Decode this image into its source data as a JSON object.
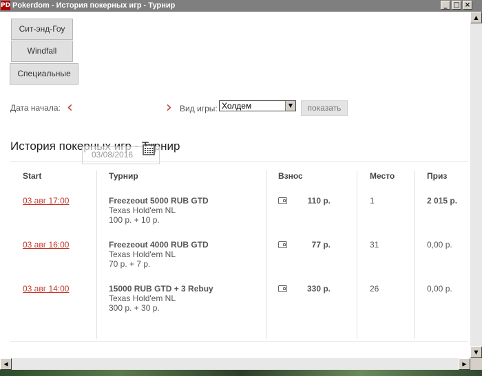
{
  "window": {
    "title": "Pokerdom - История покерных игр - Турнир",
    "icon_text": "PD",
    "buttons": [
      "_",
      "□",
      "×"
    ]
  },
  "game_tabs": [
    {
      "label": "Сит-энд-Гоу"
    },
    {
      "label": "Windfall"
    },
    {
      "label": "Специальные"
    }
  ],
  "filters": {
    "start_date_label": "Дата начала:",
    "game_type_label": "Вид игры:",
    "game_type_value": "Холдем",
    "show_button": "показать",
    "date_value": "03/08/2016"
  },
  "page_title": "История покерных игр - Турнир",
  "table": {
    "headers": {
      "start": "Start",
      "tournament": "Турнир",
      "fee": "Взнос",
      "place": "Место",
      "prize": "Приз"
    },
    "rows": [
      {
        "start": "03 авг 17:00",
        "name": "Freezeout 5000 RUB GTD",
        "game": "Texas Hold'em NL",
        "buyin": "100 р. + 10 р.",
        "fee": "110 р.",
        "place": "1",
        "prize": "2 015 р.",
        "prize_bold": true
      },
      {
        "start": "03 авг 16:00",
        "name": "Freezeout 4000 RUB GTD",
        "game": "Texas Hold'em NL",
        "buyin": "70 р. + 7 р.",
        "fee": "77 р.",
        "place": "31",
        "prize": "0,00 р.",
        "prize_bold": false
      },
      {
        "start": "03 авг 14:00",
        "name": "15000 RUB GTD + 3 Rebuy",
        "game": "Texas Hold'em NL",
        "buyin": "300 р. + 30 р.",
        "fee": "330 р.",
        "place": "26",
        "prize": "0,00 р.",
        "prize_bold": false
      }
    ]
  },
  "icons": {
    "prev": "chevron-left-icon",
    "next": "chevron-right-icon",
    "calendar": "calendar-icon",
    "fee": "wallet-icon"
  },
  "colors": {
    "accent": "#c0392b",
    "titlebar": "#7f7f7f"
  }
}
